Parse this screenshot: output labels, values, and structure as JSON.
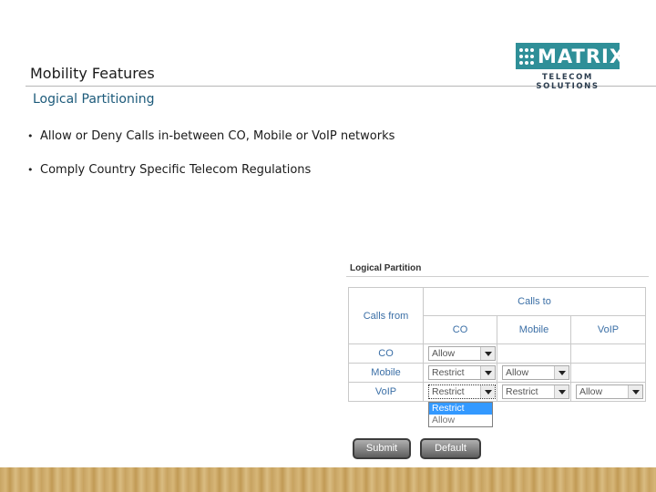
{
  "slide": {
    "title": "Mobility Features",
    "subtitle": "Logical Partitioning",
    "bullets": [
      "Allow or Deny Calls in-between CO, Mobile or VoIP networks",
      "Comply Country Specific Telecom Regulations"
    ],
    "bullet_glyph": "•"
  },
  "logo": {
    "name": "MATRIX",
    "tagline": "TELECOM SOLUTIONS",
    "color": "#2f8f98"
  },
  "panel": {
    "title": "Logical Partition",
    "calls_from_label": "Calls from",
    "calls_to_label": "Calls to",
    "columns": [
      "CO",
      "Mobile",
      "VoIP"
    ],
    "rows": [
      {
        "label": "CO",
        "values": [
          "Allow",
          "",
          ""
        ]
      },
      {
        "label": "Mobile",
        "values": [
          "Restrict",
          "Allow",
          ""
        ]
      },
      {
        "label": "VoIP",
        "values": [
          "Restrict",
          "Restrict",
          "Allow"
        ]
      }
    ],
    "open_dropdown": {
      "options": [
        "Restrict",
        "Allow"
      ],
      "highlighted": "Restrict"
    },
    "submit_label": "Submit",
    "default_label": "Default"
  }
}
